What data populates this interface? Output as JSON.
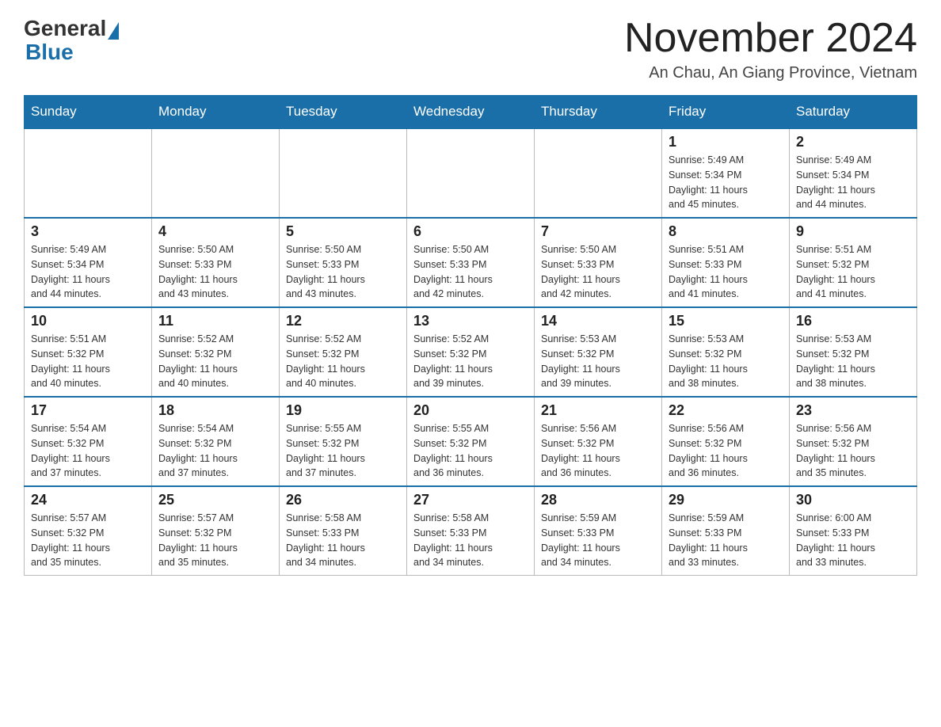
{
  "header": {
    "logo_general": "General",
    "logo_blue": "Blue",
    "title": "November 2024",
    "location": "An Chau, An Giang Province, Vietnam"
  },
  "days_of_week": [
    "Sunday",
    "Monday",
    "Tuesday",
    "Wednesday",
    "Thursday",
    "Friday",
    "Saturday"
  ],
  "weeks": [
    [
      {
        "day": "",
        "info": ""
      },
      {
        "day": "",
        "info": ""
      },
      {
        "day": "",
        "info": ""
      },
      {
        "day": "",
        "info": ""
      },
      {
        "day": "",
        "info": ""
      },
      {
        "day": "1",
        "info": "Sunrise: 5:49 AM\nSunset: 5:34 PM\nDaylight: 11 hours\nand 45 minutes."
      },
      {
        "day": "2",
        "info": "Sunrise: 5:49 AM\nSunset: 5:34 PM\nDaylight: 11 hours\nand 44 minutes."
      }
    ],
    [
      {
        "day": "3",
        "info": "Sunrise: 5:49 AM\nSunset: 5:34 PM\nDaylight: 11 hours\nand 44 minutes."
      },
      {
        "day": "4",
        "info": "Sunrise: 5:50 AM\nSunset: 5:33 PM\nDaylight: 11 hours\nand 43 minutes."
      },
      {
        "day": "5",
        "info": "Sunrise: 5:50 AM\nSunset: 5:33 PM\nDaylight: 11 hours\nand 43 minutes."
      },
      {
        "day": "6",
        "info": "Sunrise: 5:50 AM\nSunset: 5:33 PM\nDaylight: 11 hours\nand 42 minutes."
      },
      {
        "day": "7",
        "info": "Sunrise: 5:50 AM\nSunset: 5:33 PM\nDaylight: 11 hours\nand 42 minutes."
      },
      {
        "day": "8",
        "info": "Sunrise: 5:51 AM\nSunset: 5:33 PM\nDaylight: 11 hours\nand 41 minutes."
      },
      {
        "day": "9",
        "info": "Sunrise: 5:51 AM\nSunset: 5:32 PM\nDaylight: 11 hours\nand 41 minutes."
      }
    ],
    [
      {
        "day": "10",
        "info": "Sunrise: 5:51 AM\nSunset: 5:32 PM\nDaylight: 11 hours\nand 40 minutes."
      },
      {
        "day": "11",
        "info": "Sunrise: 5:52 AM\nSunset: 5:32 PM\nDaylight: 11 hours\nand 40 minutes."
      },
      {
        "day": "12",
        "info": "Sunrise: 5:52 AM\nSunset: 5:32 PM\nDaylight: 11 hours\nand 40 minutes."
      },
      {
        "day": "13",
        "info": "Sunrise: 5:52 AM\nSunset: 5:32 PM\nDaylight: 11 hours\nand 39 minutes."
      },
      {
        "day": "14",
        "info": "Sunrise: 5:53 AM\nSunset: 5:32 PM\nDaylight: 11 hours\nand 39 minutes."
      },
      {
        "day": "15",
        "info": "Sunrise: 5:53 AM\nSunset: 5:32 PM\nDaylight: 11 hours\nand 38 minutes."
      },
      {
        "day": "16",
        "info": "Sunrise: 5:53 AM\nSunset: 5:32 PM\nDaylight: 11 hours\nand 38 minutes."
      }
    ],
    [
      {
        "day": "17",
        "info": "Sunrise: 5:54 AM\nSunset: 5:32 PM\nDaylight: 11 hours\nand 37 minutes."
      },
      {
        "day": "18",
        "info": "Sunrise: 5:54 AM\nSunset: 5:32 PM\nDaylight: 11 hours\nand 37 minutes."
      },
      {
        "day": "19",
        "info": "Sunrise: 5:55 AM\nSunset: 5:32 PM\nDaylight: 11 hours\nand 37 minutes."
      },
      {
        "day": "20",
        "info": "Sunrise: 5:55 AM\nSunset: 5:32 PM\nDaylight: 11 hours\nand 36 minutes."
      },
      {
        "day": "21",
        "info": "Sunrise: 5:56 AM\nSunset: 5:32 PM\nDaylight: 11 hours\nand 36 minutes."
      },
      {
        "day": "22",
        "info": "Sunrise: 5:56 AM\nSunset: 5:32 PM\nDaylight: 11 hours\nand 36 minutes."
      },
      {
        "day": "23",
        "info": "Sunrise: 5:56 AM\nSunset: 5:32 PM\nDaylight: 11 hours\nand 35 minutes."
      }
    ],
    [
      {
        "day": "24",
        "info": "Sunrise: 5:57 AM\nSunset: 5:32 PM\nDaylight: 11 hours\nand 35 minutes."
      },
      {
        "day": "25",
        "info": "Sunrise: 5:57 AM\nSunset: 5:32 PM\nDaylight: 11 hours\nand 35 minutes."
      },
      {
        "day": "26",
        "info": "Sunrise: 5:58 AM\nSunset: 5:33 PM\nDaylight: 11 hours\nand 34 minutes."
      },
      {
        "day": "27",
        "info": "Sunrise: 5:58 AM\nSunset: 5:33 PM\nDaylight: 11 hours\nand 34 minutes."
      },
      {
        "day": "28",
        "info": "Sunrise: 5:59 AM\nSunset: 5:33 PM\nDaylight: 11 hours\nand 34 minutes."
      },
      {
        "day": "29",
        "info": "Sunrise: 5:59 AM\nSunset: 5:33 PM\nDaylight: 11 hours\nand 33 minutes."
      },
      {
        "day": "30",
        "info": "Sunrise: 6:00 AM\nSunset: 5:33 PM\nDaylight: 11 hours\nand 33 minutes."
      }
    ]
  ]
}
